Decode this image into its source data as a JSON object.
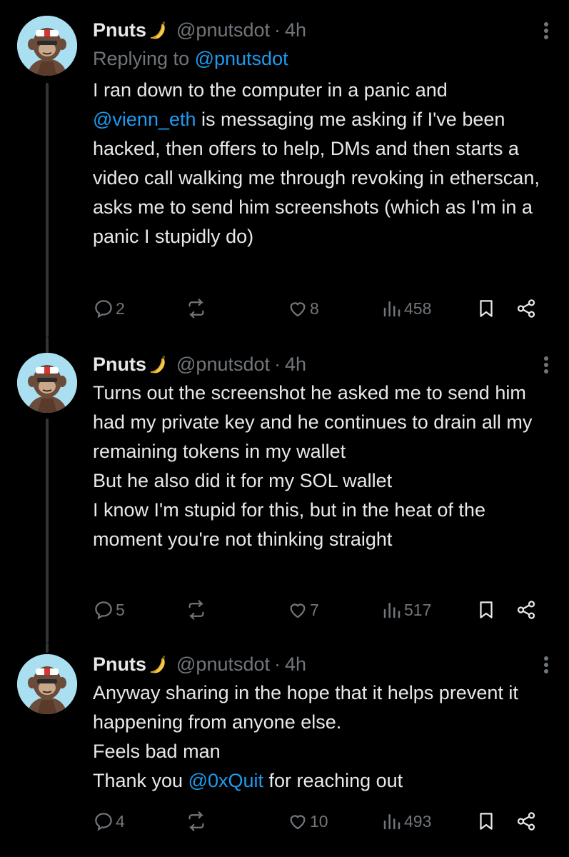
{
  "tweets": [
    {
      "name": "Pnuts",
      "handle": "@pnutsdot",
      "dot": "·",
      "time": "4h",
      "replying_prefix": "Replying to ",
      "replying_to": "@pnutsdot",
      "text_p1_before": "I ran down to the computer in a panic and",
      "text_mention": "@vienn_eth",
      "text_p1_after": " is messaging me asking if I've been hacked, then offers to help, DMs and then starts a video call walking me through revoking in etherscan, asks me to send him screenshots (which as I'm in a panic I stupidly do)",
      "replies": "2",
      "reposts": "",
      "likes": "8",
      "views": "458"
    },
    {
      "name": "Pnuts",
      "handle": "@pnutsdot",
      "dot": "·",
      "time": "4h",
      "lines": [
        "Turns out the screenshot he asked me to send him had my private key and he continues to drain all my remaining tokens in my wallet",
        "But he also did it for my SOL wallet",
        "I know I'm stupid for this, but in the heat of the moment you're not thinking straight"
      ],
      "replies": "5",
      "reposts": "",
      "likes": "7",
      "views": "517"
    },
    {
      "name": "Pnuts",
      "handle": "@pnutsdot",
      "dot": "·",
      "time": "4h",
      "lines": [
        "Anyway sharing in the hope that it helps prevent it happening from anyone else.",
        "Feels bad man"
      ],
      "thanks_before": "Thank you ",
      "thanks_mention": "@0xQuit",
      "thanks_after": " for reaching out",
      "replies": "4",
      "reposts": "",
      "likes": "10",
      "views": "493"
    }
  ],
  "colors": {
    "background": "#000000",
    "text": "#e7e9ea",
    "muted": "#71767b",
    "link": "#1d9bf0",
    "thread_line": "#333639"
  },
  "icons": [
    "more-icon",
    "reply-icon",
    "repost-icon",
    "like-icon",
    "views-icon",
    "bookmark-icon",
    "share-icon",
    "banana-emoji",
    "ape-avatar"
  ]
}
